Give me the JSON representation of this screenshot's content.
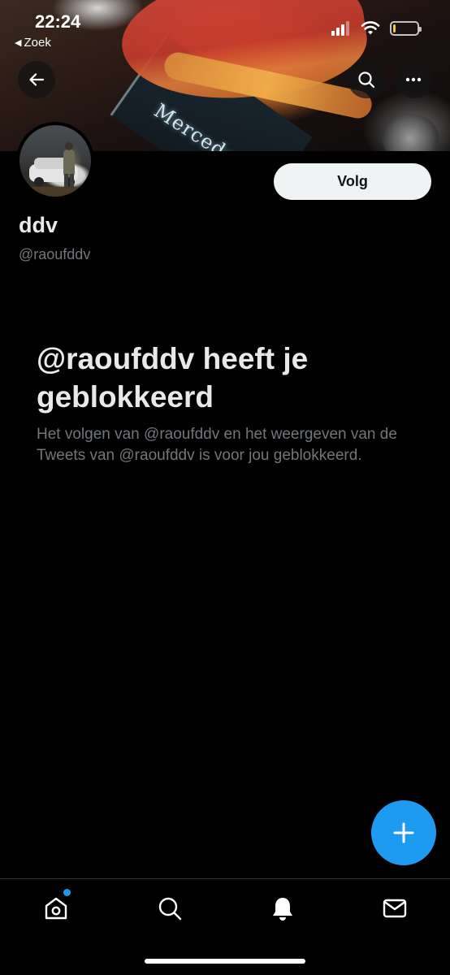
{
  "status_bar": {
    "time": "22:24",
    "back_label": "Zoek",
    "icons": [
      "cellular-signal-icon",
      "wifi-icon",
      "battery-low-icon"
    ],
    "battery_level": 0.1
  },
  "header": {
    "back_icon": "arrow-left-icon",
    "search_icon": "search-icon",
    "more_icon": "more-horizontal-icon",
    "banner_text": "Merceder"
  },
  "profile": {
    "display_name": "ddv",
    "handle": "@raoufddv",
    "follow_label": "Volg"
  },
  "blocked_notice": {
    "title": "@raoufddv heeft je geblokkeerd",
    "description": "Het volgen van @raoufddv en het weergeven van de Tweets van @raoufddv is voor jou geblokkeerd."
  },
  "fab": {
    "icon": "plus-icon"
  },
  "tab_bar": {
    "items": [
      {
        "name": "home",
        "icon": "home-icon",
        "has_dot": true
      },
      {
        "name": "search",
        "icon": "search-icon"
      },
      {
        "name": "notifications",
        "icon": "bell-icon"
      },
      {
        "name": "messages",
        "icon": "mail-icon"
      }
    ]
  },
  "colors": {
    "background": "#000000",
    "accent": "#1d9bf0",
    "primary_text": "#e7e9ea",
    "secondary_text": "#71767b",
    "battery_low": "#f2c744"
  }
}
